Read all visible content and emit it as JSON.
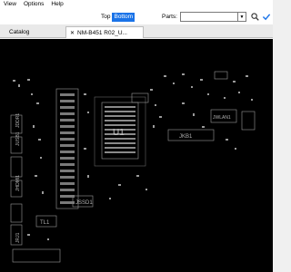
{
  "menu": {
    "items": [
      "View",
      "Options",
      "Help"
    ]
  },
  "toolbar": {
    "side_top": "Top",
    "side_bottom": "Bottom",
    "parts_label": "Parts:",
    "parts_value": ""
  },
  "tabs": {
    "catalog": "Catalog",
    "close_glyph": "✕",
    "board": "NM-B451 R02_U..."
  },
  "board": {
    "labels": {
      "cpu": "U1",
      "jkb1": "JKB1",
      "jssd1": "JSSD1",
      "tl1": "TL1",
      "wlan": "JWLAN1",
      "jddr": "JDDR1",
      "jusb": "JUSB1",
      "jhdmi": "JHDMI1",
      "jlan": "JRJ1"
    }
  },
  "colors": {
    "board_bg": "#000000",
    "outline": "#9a9a9a",
    "accent": "#1a73e8"
  }
}
